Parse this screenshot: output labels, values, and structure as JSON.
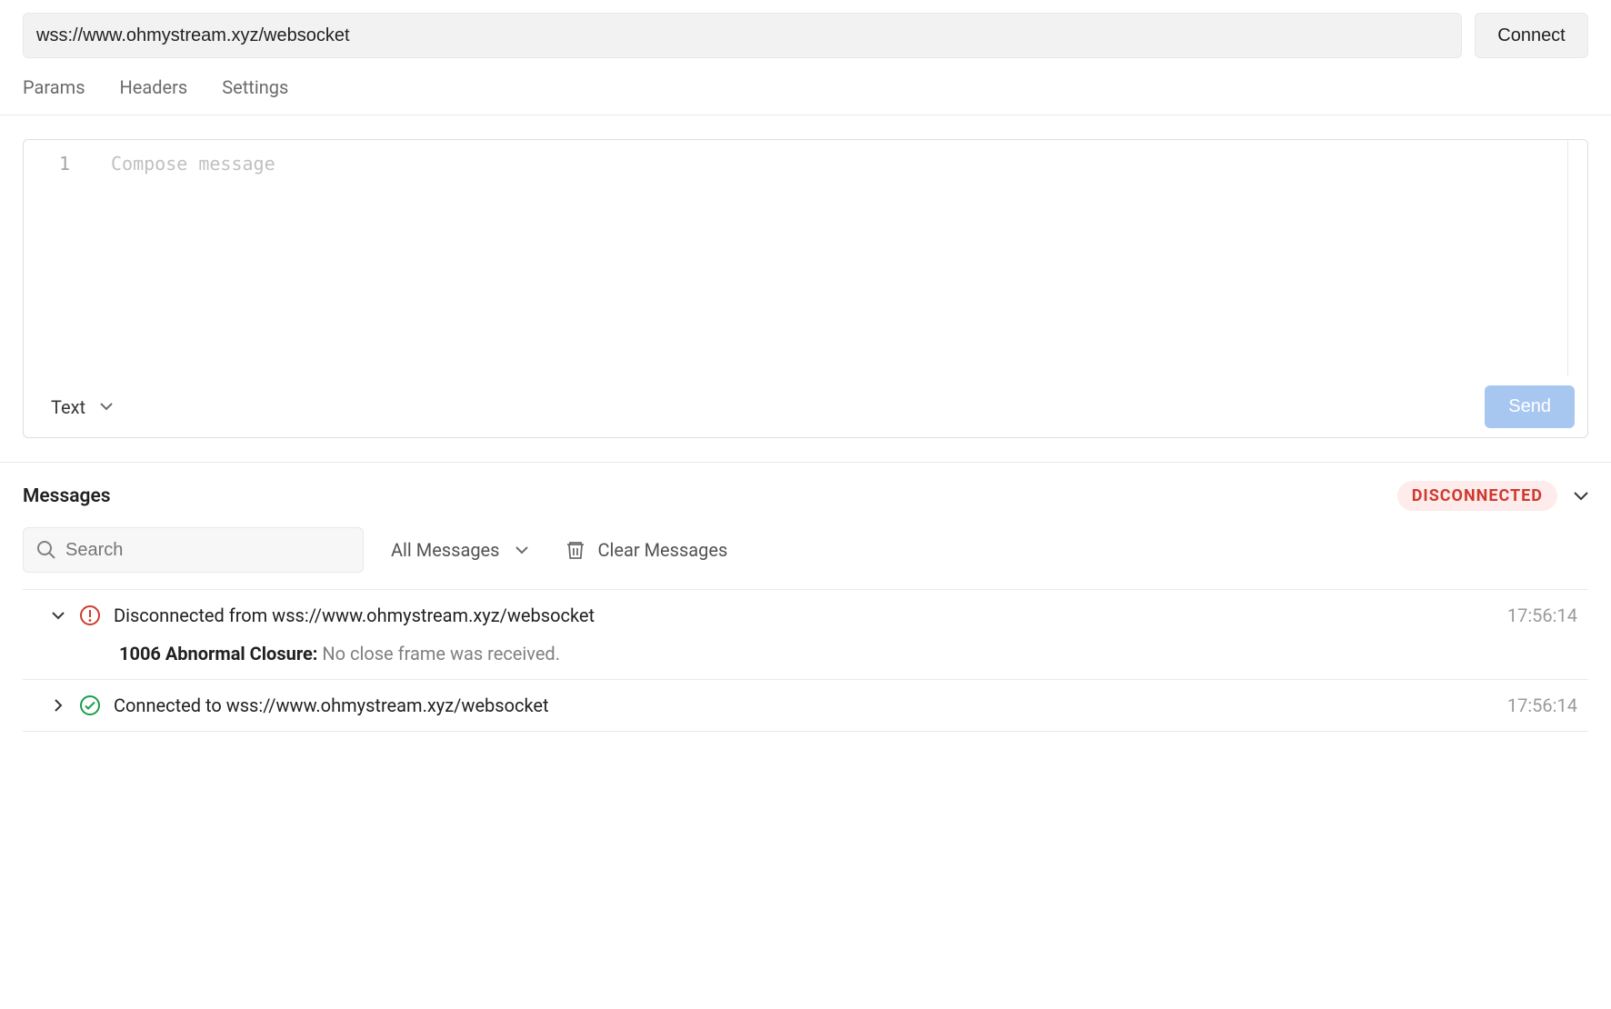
{
  "url_input": {
    "value": "wss://www.ohmystream.xyz/websocket"
  },
  "connect_button": {
    "label": "Connect"
  },
  "tabs": [
    {
      "label": "Params"
    },
    {
      "label": "Headers"
    },
    {
      "label": "Settings"
    }
  ],
  "editor": {
    "line_number": "1",
    "placeholder": "Compose message",
    "format_label": "Text",
    "send_label": "Send"
  },
  "messages_section": {
    "title": "Messages",
    "status": "DISCONNECTED",
    "search_placeholder": "Search",
    "filter_label": "All Messages",
    "clear_label": "Clear Messages"
  },
  "messages": [
    {
      "expanded": true,
      "status": "error",
      "text": "Disconnected from wss://www.ohmystream.xyz/websocket",
      "time": "17:56:14",
      "detail_bold": "1006 Abnormal Closure:",
      "detail_rest": " No close frame was received."
    },
    {
      "expanded": false,
      "status": "success",
      "text": "Connected to wss://www.ohmystream.xyz/websocket",
      "time": "17:56:14"
    }
  ]
}
